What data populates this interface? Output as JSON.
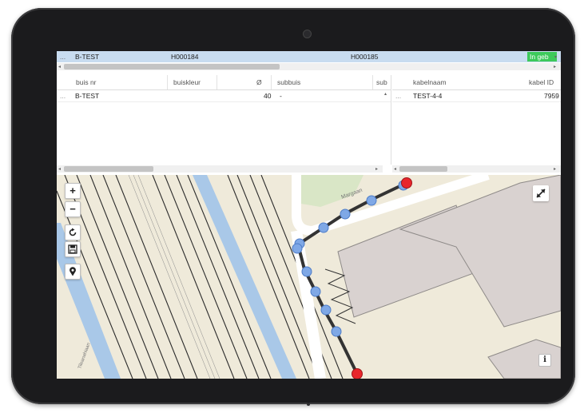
{
  "selected_row": {
    "name": "B-TEST",
    "start_node": "H000184",
    "end_node": "H000185",
    "status": "In geb"
  },
  "buis_table": {
    "columns": [
      "buis nr",
      "buiskleur",
      "Ø",
      "subbuis",
      "sub"
    ],
    "rows": [
      {
        "buis_nr": "B-TEST",
        "buiskleur": "",
        "diameter": "40",
        "subbuis": "-",
        "sub": ""
      }
    ]
  },
  "kabel_table": {
    "columns": [
      "kabelnaam",
      "kabel ID"
    ],
    "rows": [
      {
        "kabelnaam": "TEST-4-4",
        "kabel_id": "7959"
      }
    ]
  },
  "map": {
    "controls": {
      "zoom_in": "+",
      "zoom_out": "−",
      "refresh_icon": "refresh-icon",
      "save_icon": "save-icon",
      "location_icon": "location-pin-icon",
      "fullscreen_icon": "expand-icon",
      "info": "i"
    },
    "street_labels": [
      "Margaan",
      "Tileanahiaan"
    ],
    "colors": {
      "route": "#333333",
      "vertex": "#7fa8e6",
      "endpoint": "#e8262c",
      "building": "#d9d2d0",
      "canal": "#a9c8e8",
      "grass": "#d9e6c6"
    }
  }
}
